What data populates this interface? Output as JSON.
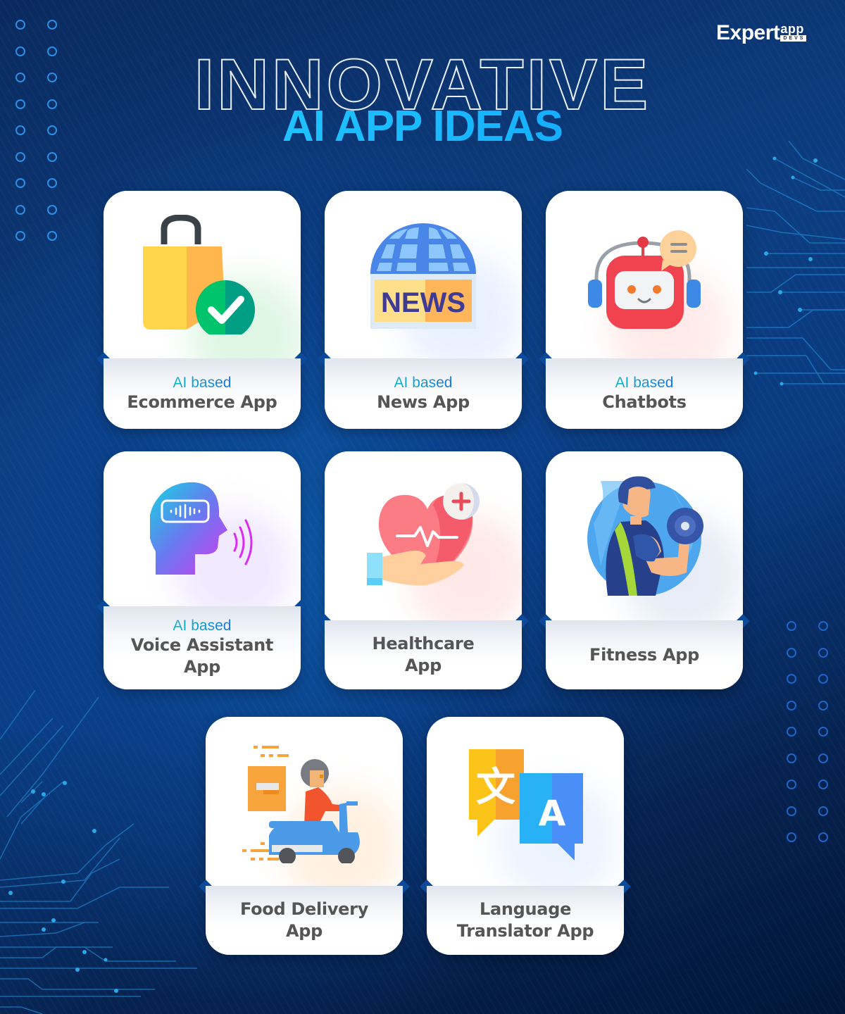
{
  "brand": {
    "logo_main": "Expert",
    "logo_sup": "app",
    "logo_sub": "DEVS"
  },
  "header": {
    "title_outline": "INNOVATIVE",
    "title_main": "AI APP IDEAS"
  },
  "cards": [
    {
      "prefix": "AI based",
      "title": "Ecommerce App",
      "icon": "shopping-bag-check-icon"
    },
    {
      "prefix": "AI based",
      "title": "News App",
      "icon": "globe-news-icon",
      "icon_text": "NEWS"
    },
    {
      "prefix": "AI based",
      "title": "Chatbots",
      "icon": "robot-headset-icon"
    },
    {
      "prefix": "AI based",
      "title_lines": [
        "Voice Assistant",
        "App"
      ],
      "icon": "head-voice-icon"
    },
    {
      "title_lines": [
        "Healthcare",
        "App"
      ],
      "icon": "heart-hand-icon"
    },
    {
      "title": "Fitness App",
      "icon": "dumbbell-athlete-icon"
    },
    {
      "title_lines": [
        "Food Delivery",
        "App"
      ],
      "icon": "scooter-delivery-icon"
    },
    {
      "title_lines": [
        "Language",
        "Translator App"
      ],
      "icon": "translate-bubbles-icon",
      "icon_text": [
        "文",
        "A"
      ]
    }
  ],
  "colors": {
    "accent_cyan": "#17b4ff",
    "label_gray": "#555555",
    "background_navy": "#0a3c82"
  }
}
